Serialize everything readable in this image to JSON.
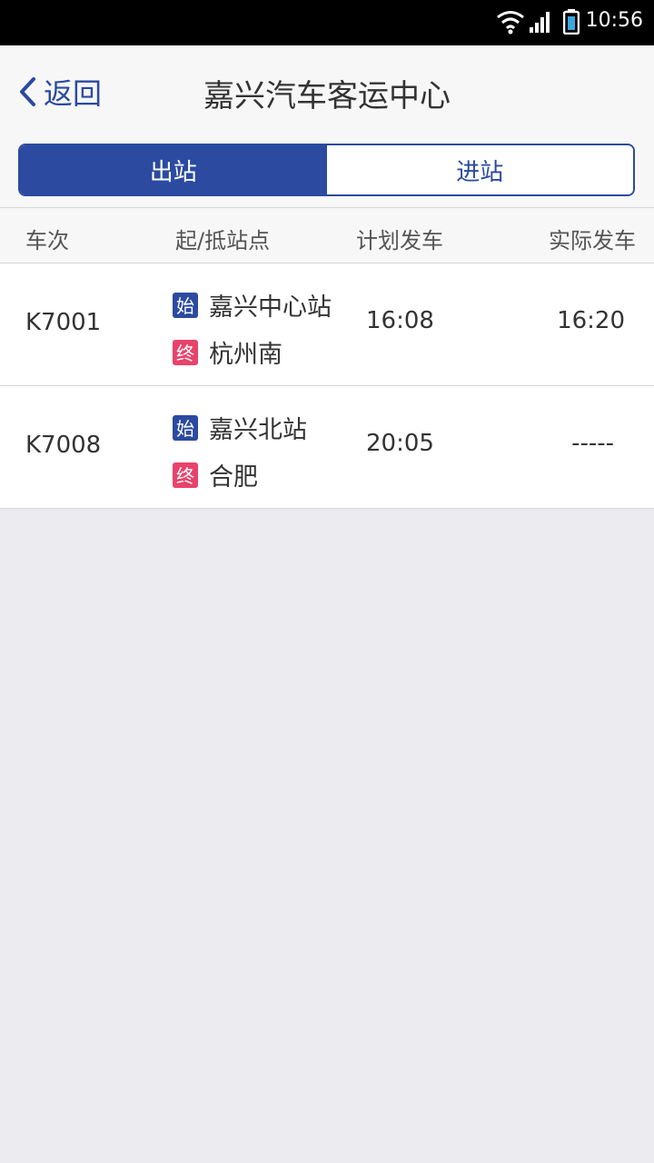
{
  "status_bar": {
    "time": "10:56"
  },
  "nav": {
    "back_label": "返回",
    "title": "嘉兴汽车客运中心"
  },
  "tabs": [
    {
      "label": "出站",
      "active": true
    },
    {
      "label": "进站",
      "active": false
    }
  ],
  "table": {
    "headers": {
      "train": "车次",
      "stations": "起/抵站点",
      "planned": "计划发车",
      "actual": "实际发车"
    },
    "start_badge": "始",
    "end_badge": "终",
    "rows": [
      {
        "train": "K7001",
        "start": "嘉兴中心站",
        "end": "杭州南",
        "planned": "16:08",
        "actual": "16:20"
      },
      {
        "train": "K7008",
        "start": "嘉兴北站",
        "end": "合肥",
        "planned": "20:05",
        "actual": "-----"
      }
    ]
  },
  "colors": {
    "accent": "#2b4aa0",
    "end_badge": "#e8436a",
    "background": "#ebebf0"
  }
}
